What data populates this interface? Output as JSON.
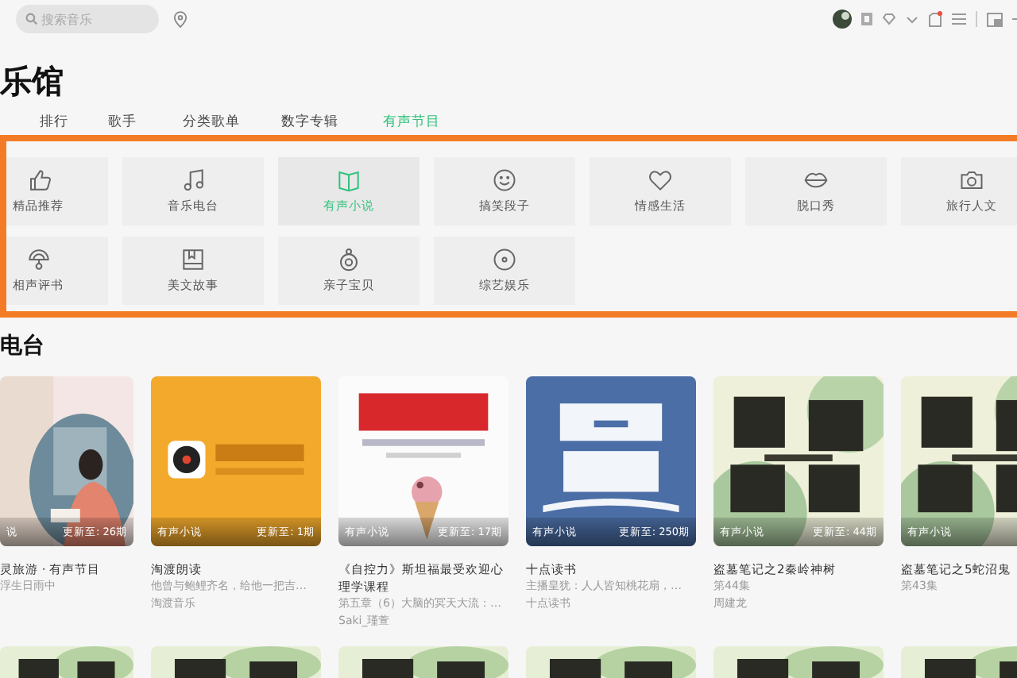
{
  "search": {
    "placeholder": "搜索音乐"
  },
  "page_title": "乐馆",
  "tabs": [
    {
      "label": "排行",
      "selected": false
    },
    {
      "label": "歌手",
      "selected": false
    },
    {
      "label": "分类歌单",
      "selected": false
    },
    {
      "label": "数字专辑",
      "selected": false
    },
    {
      "label": "有声节目",
      "selected": true
    }
  ],
  "categories": [
    {
      "label": "精品推荐",
      "selected": false
    },
    {
      "label": "音乐电台",
      "selected": false
    },
    {
      "label": "有声小说",
      "selected": true
    },
    {
      "label": "搞笑段子",
      "selected": false
    },
    {
      "label": "情感生活",
      "selected": false
    },
    {
      "label": "脱口秀",
      "selected": false
    },
    {
      "label": "旅行人文",
      "selected": false
    },
    {
      "label": "相声评书",
      "selected": false
    },
    {
      "label": "美文故事",
      "selected": false
    },
    {
      "label": "亲子宝贝",
      "selected": false
    },
    {
      "label": "综艺娱乐",
      "selected": false
    }
  ],
  "section_title": "电台",
  "cards": [
    {
      "kind": "picture",
      "badge": "说",
      "update": "更新至: 26期",
      "title": "灵旅游 · 有声节目",
      "subtitle": "浮生日雨中"
    },
    {
      "kind": "picture",
      "badge": "有声小说",
      "update": "更新至: 1期",
      "title": "淘渡朗读",
      "subtitle": "他曾与鲍鲤齐名，给他一把吉…",
      "author": "淘渡音乐"
    },
    {
      "kind": "picture",
      "badge": "有声小说",
      "update": "更新至: 17期",
      "title": "《自控力》斯坦福最受欢迎心理学课程",
      "subtitle": "第五章（6）大脑的冥天大流：…",
      "author": "Saki_瑾萱"
    },
    {
      "kind": "picture",
      "badge": "有声小说",
      "update": "更新至: 250期",
      "title": "十点读书",
      "subtitle": "主播皇犹：人人皆知桃花扇，…",
      "author": "十点读书"
    },
    {
      "kind": "picture",
      "badge": "有声小说",
      "update": "更新至: 44期",
      "title": "盗墓笔记之2秦岭神树",
      "subtitle": "第44集",
      "author": "周建龙"
    },
    {
      "kind": "picture",
      "badge": "有声小说",
      "title": "盗墓笔记之5蛇沼鬼",
      "subtitle": "第43集"
    }
  ]
}
